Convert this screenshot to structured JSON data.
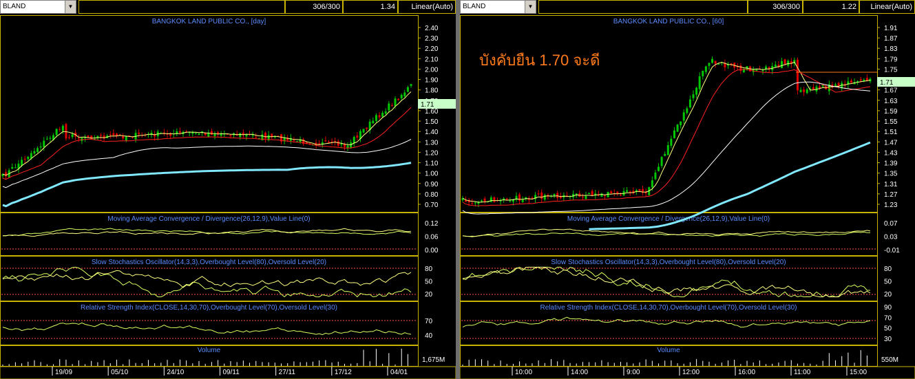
{
  "left": {
    "symbol": "BLAND",
    "count": "306/300",
    "last_value": "1.34",
    "scale_mode": "Linear(Auto)",
    "main_title": "BANGKOK LAND PUBLIC CO., [day]",
    "price_tag": "1.71",
    "price_ticks": [
      "2.40",
      "2.30",
      "2.20",
      "2.10",
      "2.00",
      "1.90",
      "1.80",
      "1.70",
      "1.60",
      "1.50",
      "1.40",
      "1.30",
      "1.20",
      "1.10",
      "1.00",
      "0.90",
      "0.80",
      "0.70"
    ],
    "macd_title": "Moving Average Convergence / Divergence(26,12,9),Value Line(0)",
    "macd_ticks": [
      "0.12",
      "0.06",
      "0.00"
    ],
    "stoch_title": "Slow Stochastics Oscillator(14,3,3),Overbought Level(80),Oversold Level(20)",
    "stoch_ticks": [
      "80",
      "50",
      "20"
    ],
    "rsi_title": "Relative Strength Index(CLOSE,14,30,70),Overbought Level(70),Oversold Level(30)",
    "rsi_ticks": [
      "70",
      "40"
    ],
    "volume_title": "Volume",
    "volume_tick": "1,675M",
    "date_labels": [
      "19/09",
      "05/10",
      "24/10",
      "09/11",
      "27/11",
      "17/12",
      "04/01"
    ]
  },
  "right": {
    "symbol": "BLAND",
    "count": "306/300",
    "last_value": "1.22",
    "scale_mode": "Linear(Auto)",
    "main_title": "BANGKOK LAND PUBLIC CO., [60]",
    "annotation": "บังคับยืน 1.70 จะดี",
    "price_tag": "1.71",
    "price_ticks": [
      "1.91",
      "1.87",
      "1.83",
      "1.79",
      "1.75",
      "1.71",
      "1.67",
      "1.63",
      "1.59",
      "1.55",
      "1.51",
      "1.47",
      "1.43",
      "1.39",
      "1.35",
      "1.31",
      "1.27",
      "1.23"
    ],
    "macd_title": "Moving Average Convergence / Divergence(26,12,9),Value Line(0)",
    "macd_ticks": [
      "0.07",
      "0.03",
      "-0.01"
    ],
    "stoch_title": "Slow Stochastics Oscillator(14,3,3),Overbought Level(80),Oversold Level(20)",
    "stoch_ticks": [
      "80",
      "50",
      "20"
    ],
    "rsi_title": "Relative Strength Index(CLOSE,14,30,70),Overbought Level(70),Oversold Level(30)",
    "rsi_ticks": [
      "90",
      "70",
      "50",
      "30"
    ],
    "volume_title": "Volume",
    "volume_tick": "550M",
    "date_labels": [
      "10:00",
      "14:00",
      "9:00",
      "12:00",
      "16:00",
      "11:00",
      "15:00"
    ]
  },
  "colors": {
    "pane_border": "#c8b400",
    "title_blue": "#5a8cff",
    "annotation": "#ff7a1a",
    "price_tag_bg": "#c8ffc8",
    "candle_up": "#00c800",
    "candle_down": "#e00000",
    "ma_short": "#ffff80",
    "ma_mid": "#ff2020",
    "ma_long": "#ffffff",
    "ma_longest": "#80e8ff",
    "osc_line": "#d8ff60",
    "level_line": "#ff5050"
  }
}
